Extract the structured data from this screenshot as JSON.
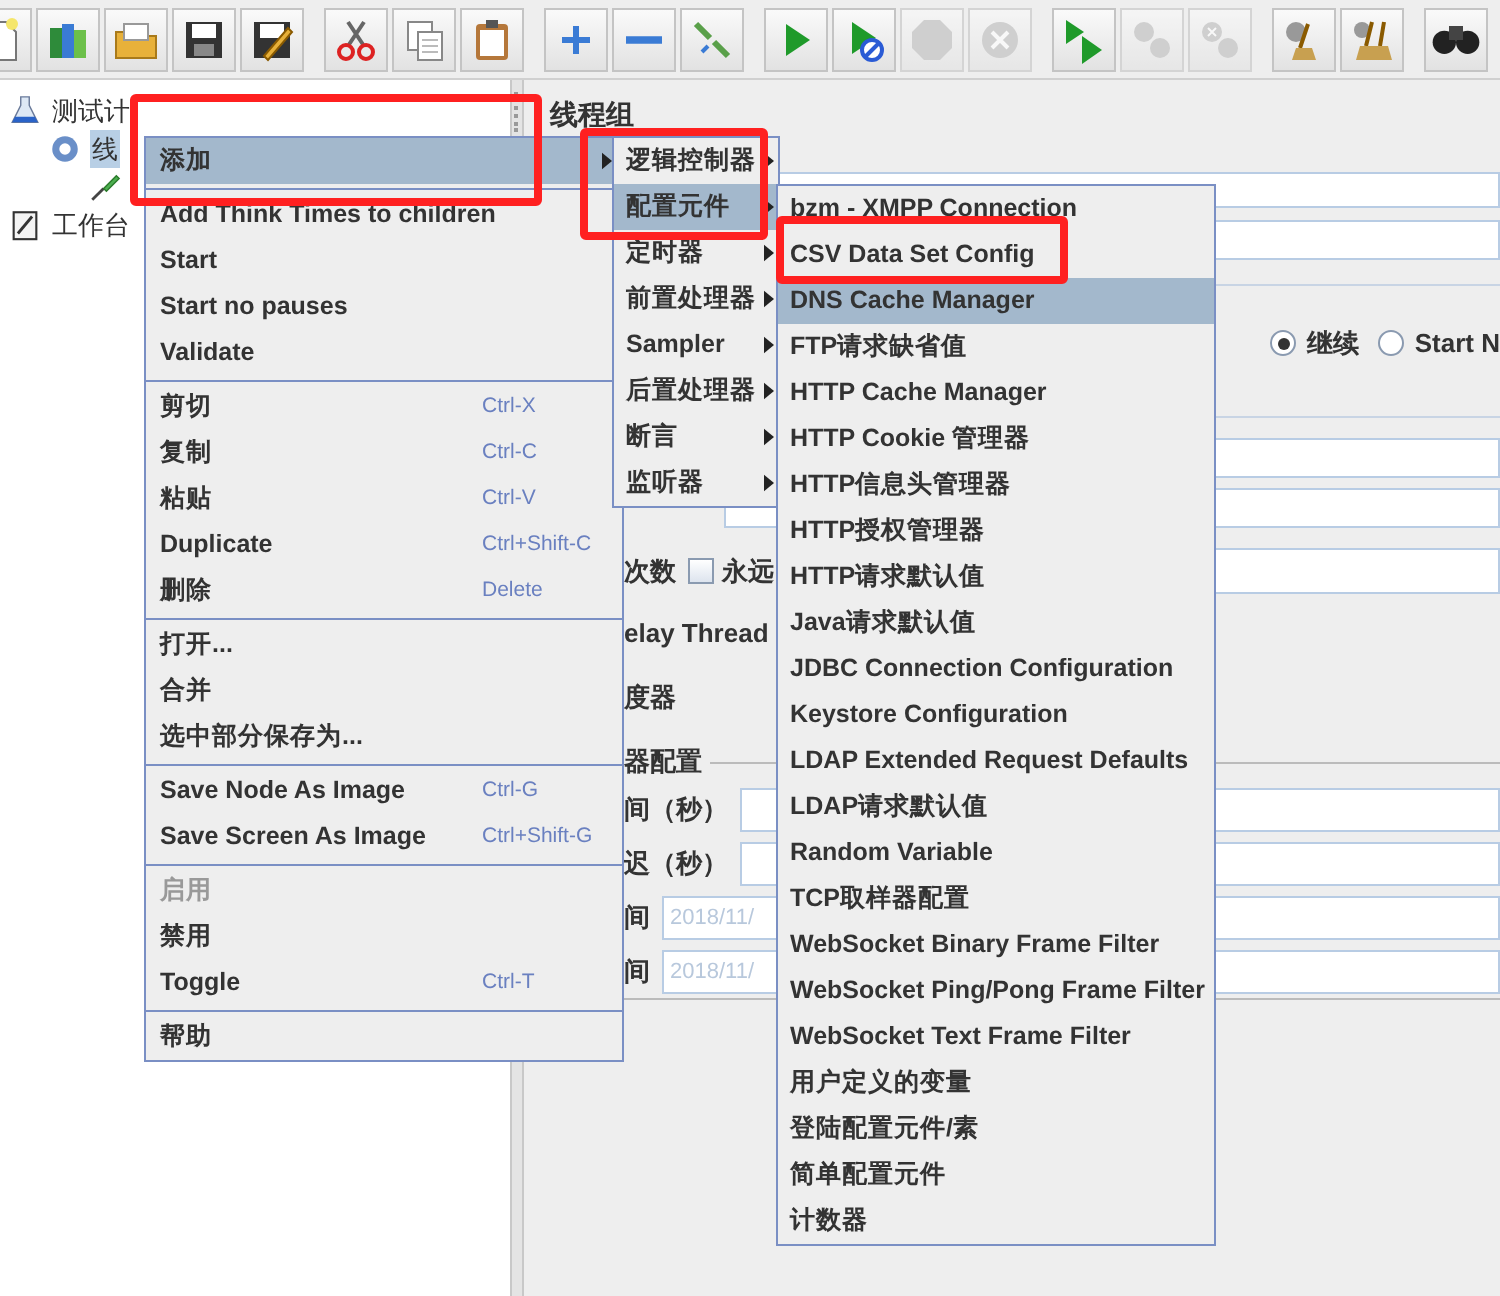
{
  "toolbar": [
    [
      {
        "kind": "new",
        "disabled": false
      },
      {
        "kind": "templates",
        "disabled": false
      },
      {
        "kind": "open",
        "disabled": false
      },
      {
        "kind": "save",
        "disabled": false
      },
      {
        "kind": "save-as",
        "disabled": false
      }
    ],
    [
      {
        "kind": "cut",
        "disabled": false
      },
      {
        "kind": "copy",
        "disabled": false
      },
      {
        "kind": "paste",
        "disabled": false
      }
    ],
    [
      {
        "kind": "expand",
        "disabled": false
      },
      {
        "kind": "collapse",
        "disabled": false
      },
      {
        "kind": "toggle",
        "disabled": false
      }
    ],
    [
      {
        "kind": "start",
        "disabled": false
      },
      {
        "kind": "start-no-pause",
        "disabled": false
      },
      {
        "kind": "stop",
        "disabled": true
      },
      {
        "kind": "shutdown",
        "disabled": true
      }
    ],
    [
      {
        "kind": "remote-start",
        "disabled": false
      },
      {
        "kind": "remote-stop",
        "disabled": true
      },
      {
        "kind": "remote-shutdown",
        "disabled": true
      }
    ],
    [
      {
        "kind": "clear",
        "disabled": false
      },
      {
        "kind": "clear-all",
        "disabled": false
      }
    ],
    [
      {
        "kind": "search",
        "disabled": false
      }
    ]
  ],
  "tree": [
    {
      "label": "测试计",
      "kind": "plan",
      "selected": false,
      "children": [
        {
          "label": "线",
          "kind": "thread-group",
          "selected": true,
          "children": [
            {
              "kind": "sampler"
            }
          ]
        }
      ]
    },
    {
      "label": "工作台",
      "kind": "workbench",
      "selected": false
    }
  ],
  "panel": {
    "title": "线程组",
    "radios": [
      {
        "label": "继续",
        "selected": true
      },
      {
        "label": "Start N",
        "selected": false
      }
    ],
    "loop_label": "次数",
    "forever": {
      "label": "永远",
      "checked": false
    },
    "delay_label": "elay Thread",
    "scheduler_label": "度器",
    "group_label": "器配置",
    "rows": [
      {
        "label": "间（秒）"
      },
      {
        "label": "迟（秒）"
      },
      {
        "label": "间",
        "value": "2018/11/"
      },
      {
        "label": "间",
        "value": "2018/11/"
      }
    ]
  },
  "context_menu": [
    [
      {
        "label": "添加",
        "submenu": true,
        "selected": true,
        "disabled": false
      }
    ],
    [
      {
        "label": "Add Think Times to children",
        "selected": false,
        "disabled": false
      },
      {
        "label": "Start",
        "selected": false,
        "disabled": false
      },
      {
        "label": "Start no pauses",
        "selected": false,
        "disabled": false
      },
      {
        "label": "Validate",
        "selected": false,
        "disabled": false
      }
    ],
    [
      {
        "label": "剪切",
        "shortcut": "Ctrl-X",
        "selected": false,
        "disabled": false
      },
      {
        "label": "复制",
        "shortcut": "Ctrl-C",
        "selected": false,
        "disabled": false
      },
      {
        "label": "粘贴",
        "shortcut": "Ctrl-V",
        "selected": false,
        "disabled": false
      },
      {
        "label": "Duplicate",
        "shortcut": "Ctrl+Shift-C",
        "selected": false,
        "disabled": false
      },
      {
        "label": "删除",
        "shortcut": "Delete",
        "selected": false,
        "disabled": false
      }
    ],
    [
      {
        "label": "打开...",
        "selected": false,
        "disabled": false
      },
      {
        "label": "合并",
        "selected": false,
        "disabled": false
      },
      {
        "label": "选中部分保存为...",
        "selected": false,
        "disabled": false
      }
    ],
    [
      {
        "label": "Save Node As Image",
        "shortcut": "Ctrl-G",
        "selected": false,
        "disabled": false
      },
      {
        "label": "Save Screen As Image",
        "shortcut": "Ctrl+Shift-G",
        "selected": false,
        "disabled": false
      }
    ],
    [
      {
        "label": "启用",
        "selected": false,
        "disabled": true
      },
      {
        "label": "禁用",
        "selected": false,
        "disabled": false
      },
      {
        "label": "Toggle",
        "shortcut": "Ctrl-T",
        "selected": false,
        "disabled": false
      }
    ],
    [
      {
        "label": "帮助",
        "selected": false,
        "disabled": false
      }
    ]
  ],
  "add_submenu": [
    {
      "label": "逻辑控制器",
      "selected": false
    },
    {
      "label": "配置元件",
      "selected": true
    },
    {
      "label": "定时器",
      "selected": false
    },
    {
      "label": "前置处理器",
      "selected": false
    },
    {
      "label": "Sampler",
      "selected": false
    },
    {
      "label": "后置处理器",
      "selected": false
    },
    {
      "label": "断言",
      "selected": false
    },
    {
      "label": "监听器",
      "selected": false
    }
  ],
  "config_submenu": [
    {
      "label": "bzm - XMPP Connection",
      "selected": false
    },
    {
      "label": "CSV Data Set Config",
      "selected": false
    },
    {
      "label": "DNS Cache Manager",
      "selected": true
    },
    {
      "label": "FTP请求缺省值",
      "selected": false
    },
    {
      "label": "HTTP Cache Manager",
      "selected": false
    },
    {
      "label": "HTTP Cookie 管理器",
      "selected": false
    },
    {
      "label": "HTTP信息头管理器",
      "selected": false
    },
    {
      "label": "HTTP授权管理器",
      "selected": false
    },
    {
      "label": "HTTP请求默认值",
      "selected": false
    },
    {
      "label": "Java请求默认值",
      "selected": false
    },
    {
      "label": "JDBC Connection Configuration",
      "selected": false
    },
    {
      "label": "Keystore Configuration",
      "selected": false
    },
    {
      "label": "LDAP Extended Request Defaults",
      "selected": false
    },
    {
      "label": "LDAP请求默认值",
      "selected": false
    },
    {
      "label": "Random Variable",
      "selected": false
    },
    {
      "label": "TCP取样器配置",
      "selected": false
    },
    {
      "label": "WebSocket Binary Frame Filter",
      "selected": false
    },
    {
      "label": "WebSocket Ping/Pong Frame Filter",
      "selected": false
    },
    {
      "label": "WebSocket Text Frame Filter",
      "selected": false
    },
    {
      "label": "用户定义的变量",
      "selected": false
    },
    {
      "label": "登陆配置元件/素",
      "selected": false
    },
    {
      "label": "简单配置元件",
      "selected": false
    },
    {
      "label": "计数器",
      "selected": false
    }
  ]
}
